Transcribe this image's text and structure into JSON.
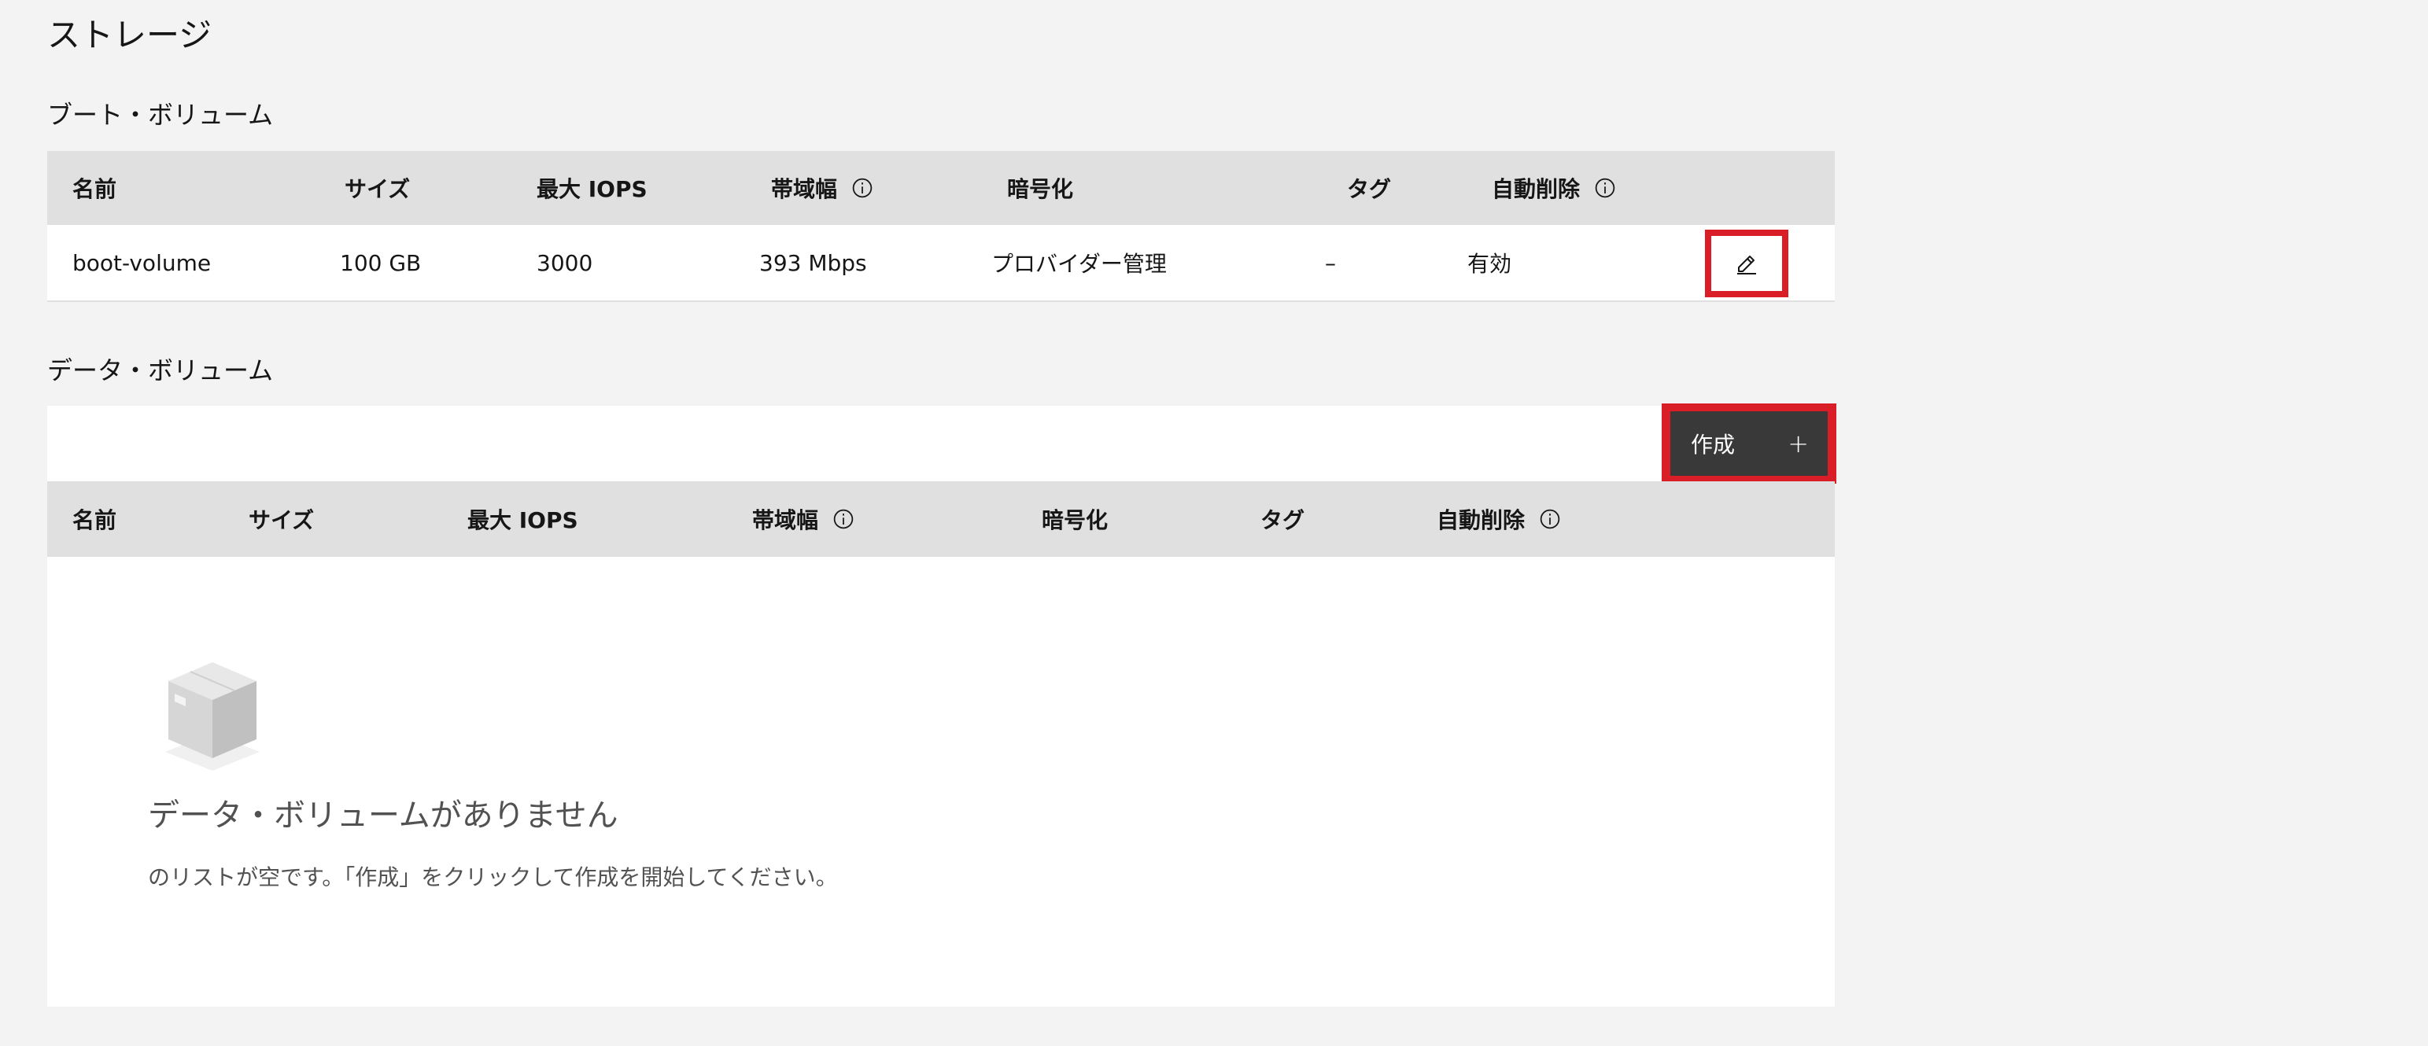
{
  "page_title": "ストレージ",
  "boot_volume": {
    "section_title": "ブート・ボリューム",
    "headers": {
      "name": "名前",
      "size": "サイズ",
      "max_iops": "最大 IOPS",
      "bandwidth": "帯域幅",
      "encryption": "暗号化",
      "tags": "タグ",
      "auto_delete": "自動削除"
    },
    "row": {
      "name": "boot-volume",
      "size": "100 GB",
      "max_iops": "3000",
      "bandwidth": "393 Mbps",
      "encryption": "プロバイダー管理",
      "tags": "–",
      "auto_delete": "有効"
    },
    "edit_icon": "pencil-icon"
  },
  "data_volume": {
    "section_title": "データ・ボリューム",
    "create_label": "作成",
    "create_icon": "+",
    "settings_icon": "gear-icon",
    "headers": {
      "name": "名前",
      "size": "サイズ",
      "max_iops": "最大 IOPS",
      "bandwidth": "帯域幅",
      "encryption": "暗号化",
      "tags": "タグ",
      "auto_delete": "自動削除"
    },
    "empty_state": {
      "icon": "box-icon",
      "title": "データ・ボリュームがありません",
      "description": "のリストが空です。「作成」をクリックして作成を開始してください。"
    }
  },
  "colors": {
    "highlight": "#da1e28",
    "button_dark": "#393939",
    "header_bg": "#e0e0e0",
    "page_bg": "#f3f3f3"
  }
}
